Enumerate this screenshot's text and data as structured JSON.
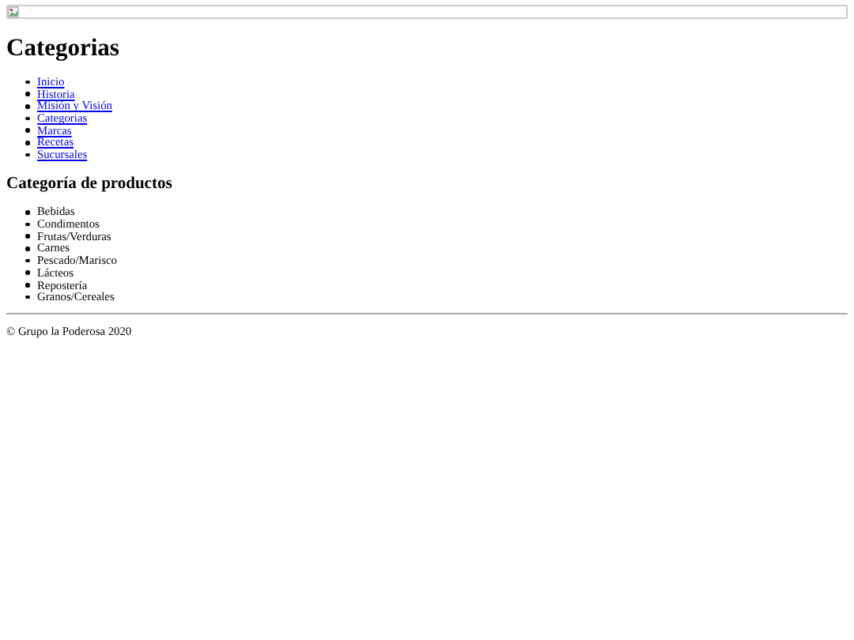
{
  "banner": {
    "kind": "picture"
  },
  "title": "Categorias",
  "nav": [
    "Inicio",
    "Historia",
    "Misión y Visión",
    "Categorias",
    "Marcas",
    "Recetas",
    "Sucursales"
  ],
  "section_title": "Categoría de productos",
  "categories": [
    "Bebidas",
    "Condimentos",
    "Frutas/Verduras",
    "Carnes",
    "Pescado/Marisco",
    "Lácteos",
    "Repostería",
    "Granos/Cereales"
  ],
  "footer": "© Grupo la Poderosa 2020"
}
